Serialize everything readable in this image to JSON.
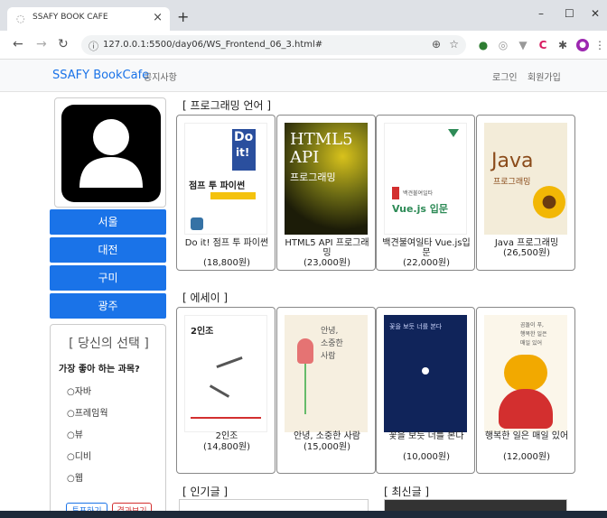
{
  "browser": {
    "tab_title": "SSAFY BOOK CAFE",
    "tab_close": "×",
    "new_tab": "+",
    "url": "127.0.0.1:5500/day06/WS_Frontend_06_3.html#",
    "win_min": "–",
    "win_max": "☐",
    "win_close": "✕"
  },
  "header": {
    "brand": "SSAFY BookCafe",
    "notice": "공지사항",
    "login": "로그인",
    "signup": "회원가입"
  },
  "sidebar": {
    "cities": [
      "서울",
      "대전",
      "구미",
      "광주"
    ],
    "survey_title": "[ 당신의 선택 ]",
    "survey_question": "가장 좋아 하는 과목?",
    "options": [
      "○자바",
      "○프레임웍",
      "○뷰",
      "○디비",
      "○웹"
    ],
    "vote_button": "투표하기",
    "result_button": "결과보기"
  },
  "sections": {
    "programming": {
      "title": "[ 프로그래밍 언어 ]",
      "books": [
        {
          "name": "Do it! 점프 투 파이썬",
          "price": "(18,800원)"
        },
        {
          "name": "HTML5 API 프로그래밍",
          "price": "(23,000원)"
        },
        {
          "name": "백견불여일타 Vue.js입문",
          "price": "(22,000원)"
        },
        {
          "name": "Java 프로그래밍",
          "price": "(26,500원)"
        }
      ]
    },
    "essay": {
      "title": "[ 에세이 ]",
      "books": [
        {
          "name": "2인조",
          "price": "(14,800원)"
        },
        {
          "name": "안녕, 소중한 사람",
          "price": "(15,000원)"
        },
        {
          "name": "꽃을 보듯 너를 본다",
          "price": "(10,000원)"
        },
        {
          "name": "행복한 일은 매일 있어",
          "price": "(12,000원)"
        }
      ]
    },
    "popular": {
      "title": "[ 인기글 ]"
    },
    "latest": {
      "title": "[ 최신글 ]"
    }
  },
  "covers": {
    "b1": {
      "line1": "Do",
      "line2": "it!",
      "line3": "점프 투 파이썬"
    },
    "b2": {
      "line1": "HTML5",
      "line2": "API",
      "line3": "프로그래밍"
    },
    "b3": {
      "line1": "백견불여일타",
      "line2": "Vue.js 입문"
    },
    "b4": {
      "line1": "Java",
      "line2": "프로그래밍"
    },
    "b5": {
      "line1": "2인조"
    },
    "b6": {
      "line1": "안녕,",
      "line2": "소중한",
      "line3": "사람"
    },
    "b7": {
      "line1": "꽃을 보듯 너를 본다"
    },
    "b8": {
      "line1": "곰돌이 푸,",
      "line2": "행복한 일은",
      "line3": "매일 있어"
    }
  },
  "colors": {
    "accent": "#1a73e8",
    "header_bg": "#f8f9fa"
  }
}
